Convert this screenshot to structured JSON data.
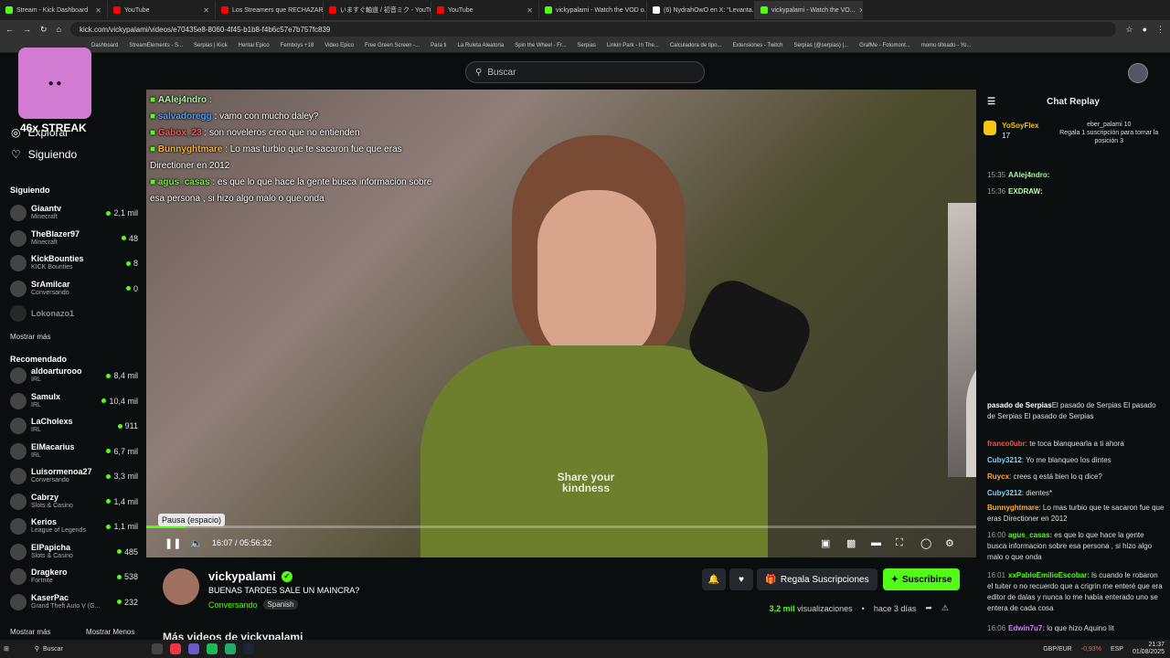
{
  "browser": {
    "tabs": [
      {
        "title": "Stream - Kick Dashboard",
        "color": "#53fc18",
        "active": false
      },
      {
        "title": "YouTube",
        "color": "#ff0000",
        "active": false
      },
      {
        "title": "Los Streamers que RECHAZAR...",
        "color": "#ff0000",
        "active": false
      },
      {
        "title": "いますぐ軸道 / 初音ミク - YouTub...",
        "color": "#ff0000",
        "active": false
      },
      {
        "title": "YouTube",
        "color": "#ff0000",
        "active": false
      },
      {
        "title": "vickypalami - Watch the VOD o...",
        "color": "#53fc18",
        "active": false
      },
      {
        "title": "(6) NydrahOwO en X: \"Levanta...",
        "color": "#ffffff",
        "active": false
      },
      {
        "title": "vickypalami - Watch the VO...",
        "color": "#53fc18",
        "active": true
      }
    ],
    "url": "kick.com/vickypalami/videos/e70435e8-8060-4f45-b1b8-f4b6c57e7b757fc839",
    "bookmarks": [
      "Dashboard",
      "StreamElements - S...",
      "Serpias | Kick",
      "Hentai Epico",
      "Femboys +18",
      "Video Epico",
      "Free Green Screen -...",
      "Para ti",
      "La Ruleta Aleatoria",
      "Spin the Wheel - Fr...",
      "Serpias",
      "Linkin Park - In The...",
      "Calculadora de tipo...",
      "Extensiones - Twitch",
      "Serpias (@serpias) |...",
      "GrafMe - Fotomont...",
      "momo tilteado - Yo..."
    ]
  },
  "search": {
    "placeholder": "Buscar"
  },
  "sidebar": {
    "streak": "46x STREAK",
    "explore": "Explorar",
    "following_nav": "Siguiendo",
    "following_title": "Siguiendo",
    "following": [
      {
        "name": "Giaantv",
        "cat": "Minecraft",
        "viewers": "2,1 mil"
      },
      {
        "name": "TheBlazer97",
        "cat": "Minecraft",
        "viewers": "48"
      },
      {
        "name": "KickBounties",
        "cat": "KICK Bounties",
        "viewers": "8"
      },
      {
        "name": "SrAmilcar",
        "cat": "Conversando",
        "viewers": "0"
      },
      {
        "name": "Lokonazo1",
        "cat": "",
        "viewers": ""
      }
    ],
    "show_more": "Mostrar más",
    "recommended_title": "Recomendado",
    "recommended": [
      {
        "name": "aldoarturooo",
        "cat": "IRL",
        "viewers": "8,4 mil"
      },
      {
        "name": "Samulx",
        "cat": "IRL",
        "viewers": "10,4 mil"
      },
      {
        "name": "LaCholexs",
        "cat": "IRL",
        "viewers": "911"
      },
      {
        "name": "ElMacarius",
        "cat": "IRL",
        "viewers": "6,7 mil"
      },
      {
        "name": "Luisormenoa27",
        "cat": "Conversando",
        "viewers": "3,3 mil"
      },
      {
        "name": "Cabrzy",
        "cat": "Slots & Casino",
        "viewers": "1,4 mil"
      },
      {
        "name": "Kerios",
        "cat": "League of Legends",
        "viewers": "1,1 mil"
      },
      {
        "name": "ElPapicha",
        "cat": "Slots & Casino",
        "viewers": "485"
      },
      {
        "name": "Dragkero",
        "cat": "Fortnite",
        "viewers": "538"
      },
      {
        "name": "KaserPac",
        "cat": "Grand Theft Auto V (G...",
        "viewers": "232"
      }
    ],
    "show_more2": "Mostrar más",
    "show_less": "Mostrar Menos"
  },
  "overlay_chat": [
    {
      "user": "AAlej4ndro",
      "color": "#a7f3a0",
      "text": ":"
    },
    {
      "user": "salvadoregg",
      "color": "#3fa0ff",
      "text": ": vamo con mucho daley?"
    },
    {
      "user": "Gabox_23",
      "color": "#ff4d4d",
      "text": ": son noveleros creo que no entienden"
    },
    {
      "user": "Bunnyghtmare",
      "color": "#ffb020",
      "text": ": Lo mas turbio que te sacaron fue que eras Directioner en 2012"
    },
    {
      "user": "agus_casas",
      "color": "#53fc18",
      "text": ": es que lo que hace la gente busca informacion sobre esa persona , si hizo algo malo o que onda"
    }
  ],
  "video": {
    "shirt_text": "Share your kindness",
    "tooltip": "Pausa (espacio)",
    "time_current": "16:07",
    "time_sep": "/",
    "time_total": "05:56:32",
    "progress": 0.047
  },
  "info": {
    "channel": "vickypalami",
    "title": "BUENAS TARDES SALE UN MAINCRA?",
    "category": "Conversando",
    "language": "Spanish",
    "gift_button": "Regala Suscripciones",
    "subscribe_button": "Suscribirse",
    "views": "3,2 mil",
    "views_label": "visualizaciones",
    "bullet": "•",
    "ago": "hace 3 días",
    "more_videos": "Más videos de vickypalami"
  },
  "chat": {
    "title": "Chat Replay",
    "gifter": "YoSoyFlex",
    "gifter_count": "17",
    "gift_user": "eber_palami",
    "gift_user_count": "10",
    "gift_text": "Regala 1 suscripción para tomar la posición 3",
    "messages": [
      {
        "time": "15:35",
        "user": "AAlej4ndro:",
        "color": "#a7f3a0",
        "text": ""
      },
      {
        "time": "15:36",
        "user": "EXDRAW:",
        "color": "#b7ff9a",
        "text": ""
      },
      {
        "time": "",
        "user": "pasado de Serpias",
        "color": "#ffffff",
        "text": "El pasado de Serpias El pasado de Serpias El pasado de Serpias"
      },
      {
        "time": "",
        "user": "franco0ubr",
        "color": "#ff4d4d",
        "text": ": te toca blanquearla a ti ahora"
      },
      {
        "time": "",
        "user": "Cuby3212",
        "color": "#7fd4ff",
        "text": ": Yo me blanqueo los dintes"
      },
      {
        "time": "",
        "user": "Ruycx",
        "color": "#ffb020",
        "text": ": crees q está bien lo q dice?"
      },
      {
        "time": "",
        "user": "Cuby3212",
        "color": "#7fd4ff",
        "text": ": dientes*"
      },
      {
        "time": "",
        "user": "Bunnyghtmare",
        "color": "#ffb020",
        "text": ": Lo mas turbio que te sacaron fue que eras Directioner en 2012"
      },
      {
        "time": "16:00",
        "user": "agus_casas:",
        "color": "#53fc18",
        "text": " es que lo que hace la gente busca informacion sobre esa persona , si hizo algo malo o que onda"
      },
      {
        "time": "16:01",
        "user": "xxPabloEmilioEscobar:",
        "color": "#53fc18",
        "text": " ls cuando le robaron el tuiter o no recuerdo que a crigrin me enteré que era editor de dalas y nunca lo me había enterado uno se entera de cada cosa"
      },
      {
        "time": "16:06",
        "user": "Edwin7u7:",
        "color": "#d480ff",
        "text": " lo que hizo Aquino lit"
      }
    ]
  },
  "taskbar": {
    "search": "Buscar",
    "ticker": "GBP/EUR",
    "ticker_change": "-0,93%",
    "lang": "ESP",
    "time": "21:37",
    "date": "01/08/2025"
  }
}
